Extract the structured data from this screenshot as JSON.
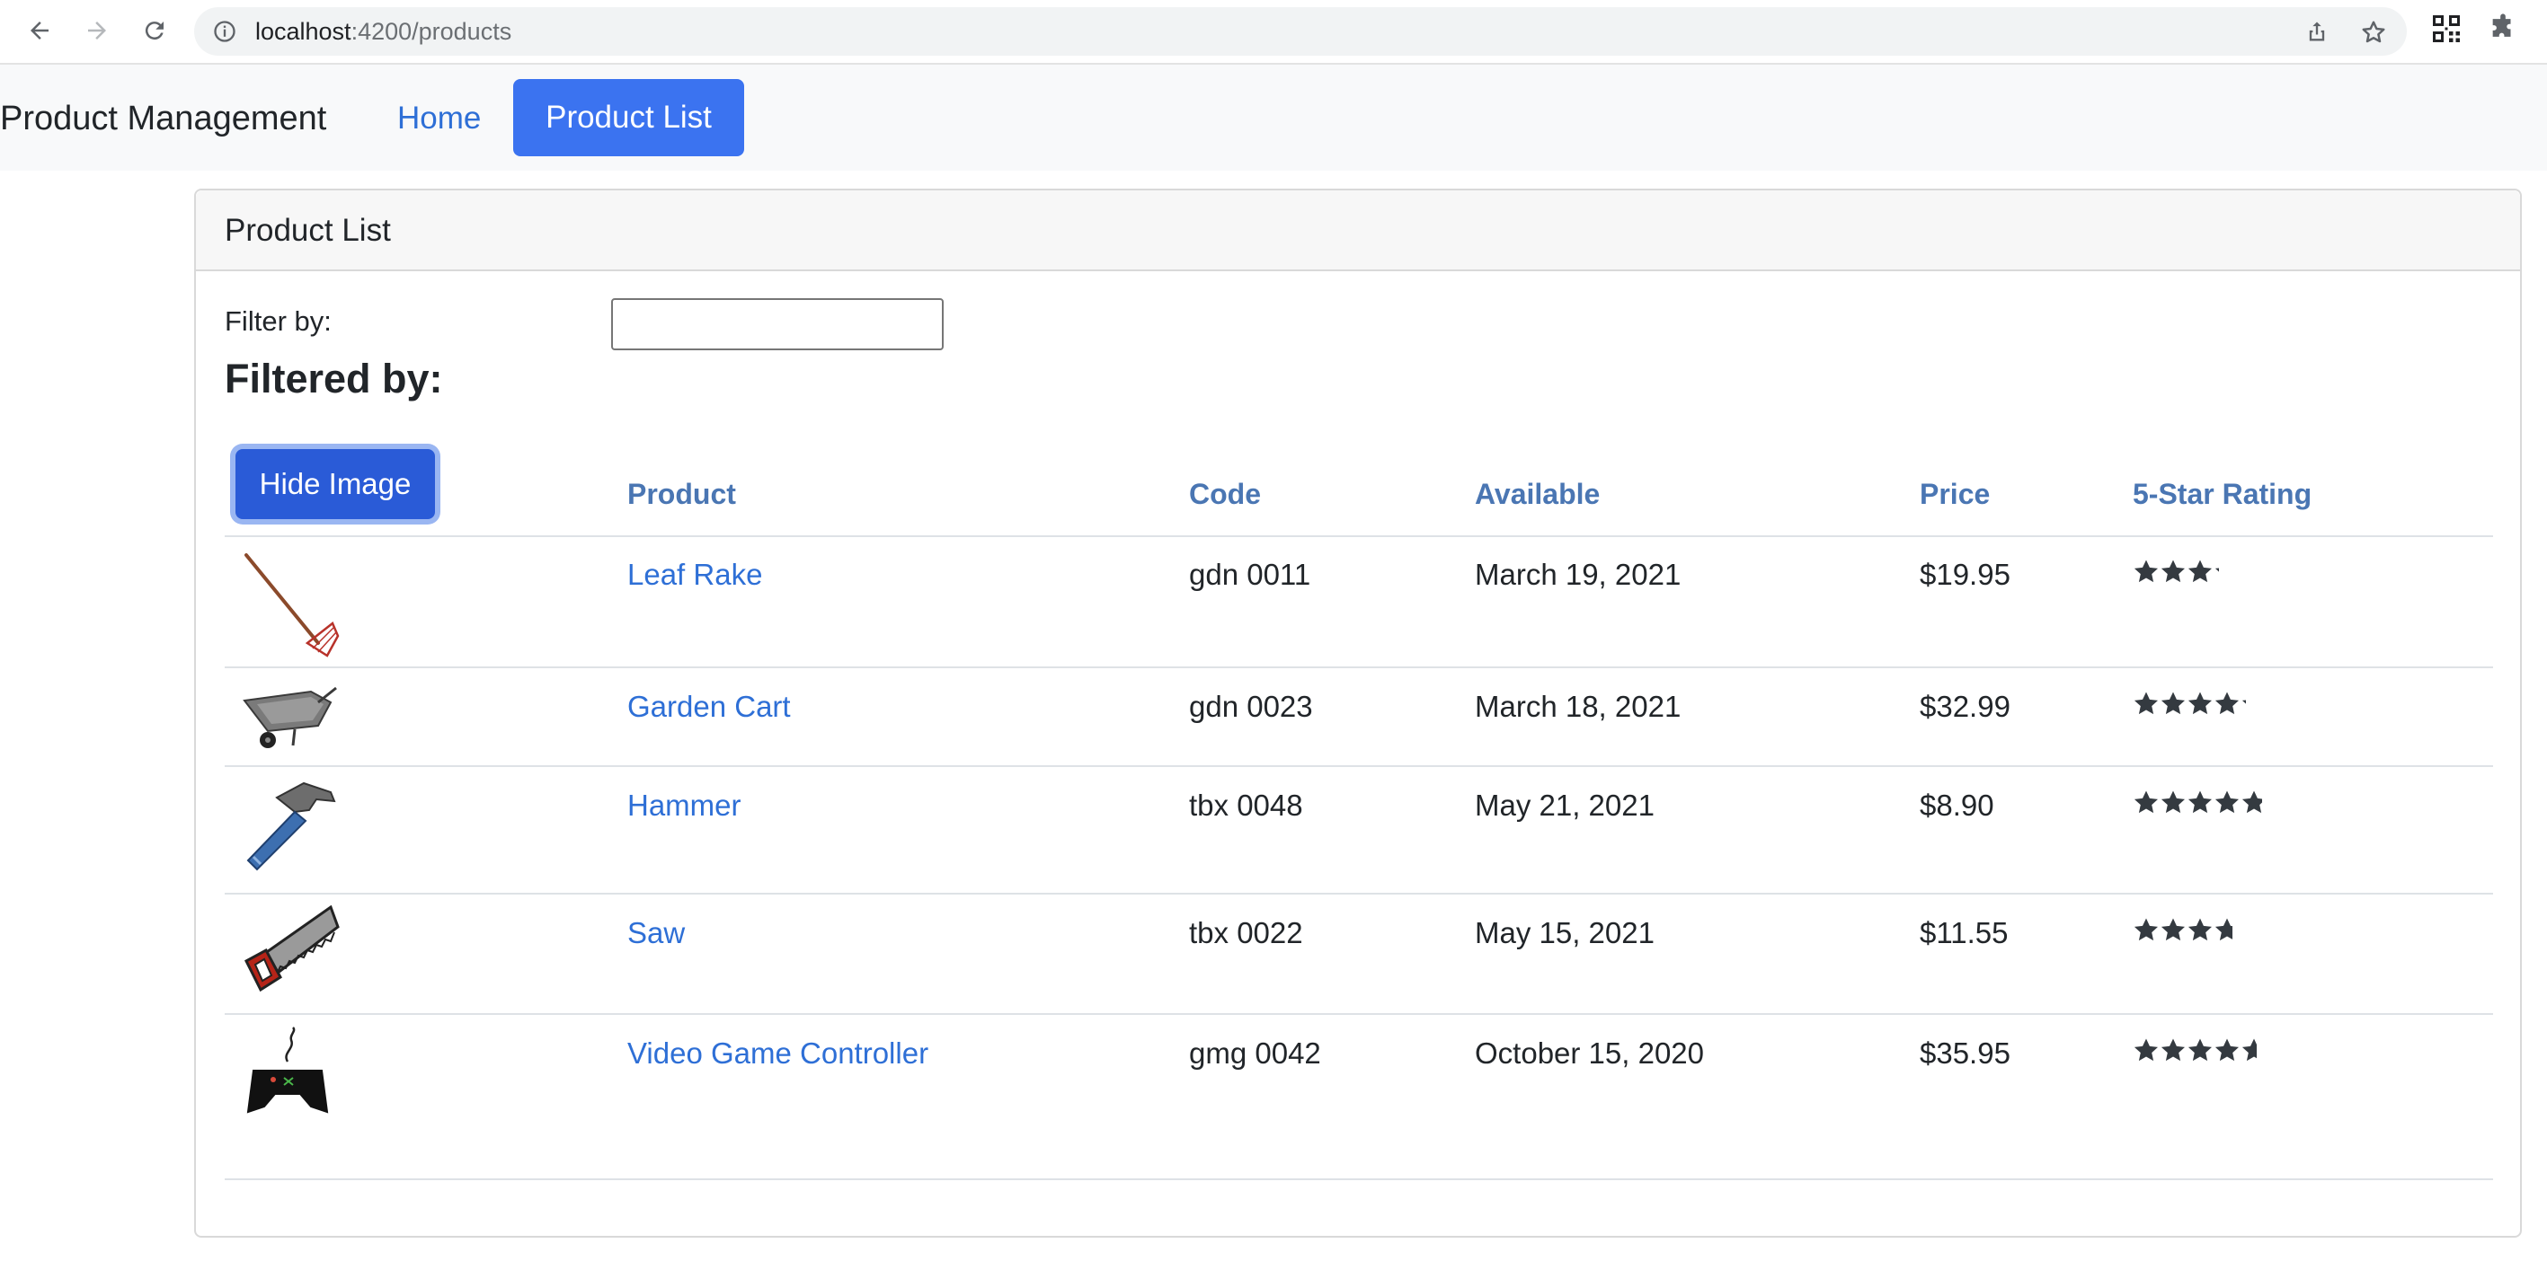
{
  "browser": {
    "url_host": "localhost",
    "url_path": ":4200/products"
  },
  "navbar": {
    "brand": "Product Management",
    "home_label": "Home",
    "active_label": "Product List"
  },
  "card": {
    "title": "Product List",
    "filter_label": "Filter by:",
    "filter_value": "",
    "filtered_by": "Filtered by:",
    "hide_image_label": "Hide Image"
  },
  "table": {
    "headers": [
      "Product",
      "Code",
      "Available",
      "Price",
      "5-Star Rating"
    ],
    "rows": [
      {
        "name": "Leaf Rake",
        "code": "gdn 0011",
        "available": "March 19, 2021",
        "price": "$19.95",
        "rating": 3.2,
        "image": "rake-icon"
      },
      {
        "name": "Garden Cart",
        "code": "gdn 0023",
        "available": "March 18, 2021",
        "price": "$32.99",
        "rating": 4.2,
        "image": "garden-cart-icon"
      },
      {
        "name": "Hammer",
        "code": "tbx 0048",
        "available": "May 21, 2021",
        "price": "$8.90",
        "rating": 4.8,
        "image": "hammer-icon"
      },
      {
        "name": "Saw",
        "code": "tbx 0022",
        "available": "May 15, 2021",
        "price": "$11.55",
        "rating": 3.7,
        "image": "saw-icon"
      },
      {
        "name": "Video Game Controller",
        "code": "gmg 0042",
        "available": "October 15, 2020",
        "price": "$35.95",
        "rating": 4.6,
        "image": "game-controller-icon"
      }
    ]
  },
  "colors": {
    "accent": "#3b73f0",
    "link": "#2e6fd6",
    "header_text": "#4a76b3",
    "star": "#343a40"
  }
}
